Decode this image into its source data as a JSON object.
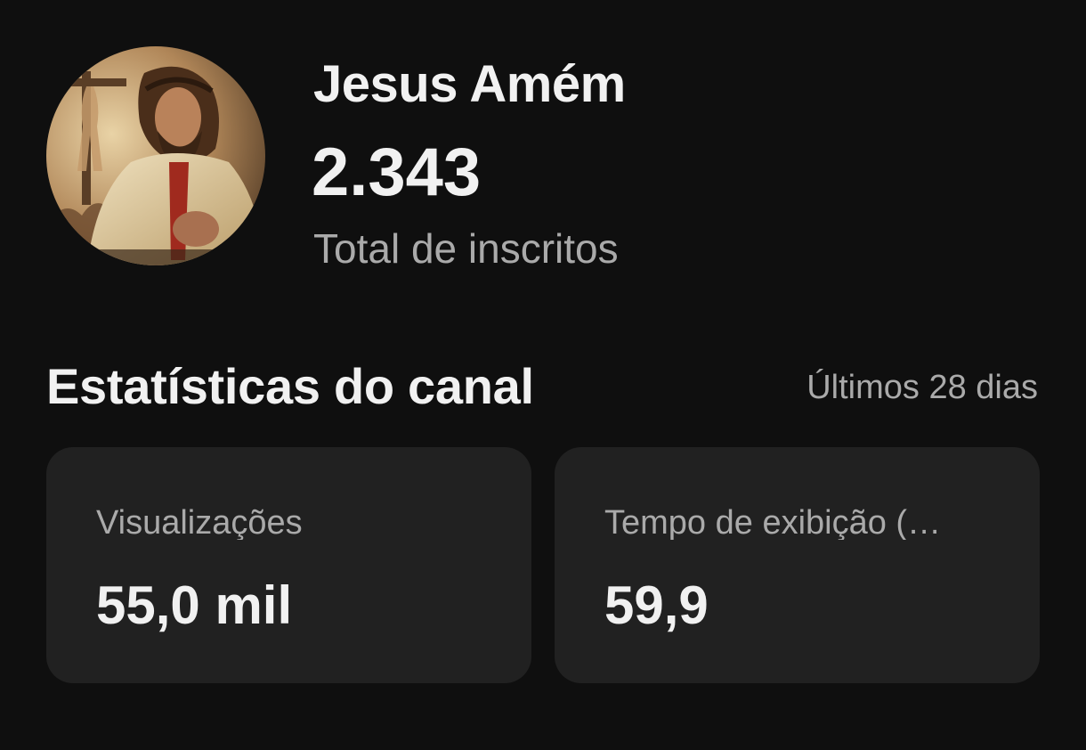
{
  "channel": {
    "name": "Jesus Amém",
    "subscriber_count": "2.343",
    "subscriber_label": "Total de inscritos",
    "avatar_icon": "channel-avatar-image"
  },
  "stats": {
    "title": "Estatísticas do canal",
    "period": "Últimos 28 dias",
    "cards": [
      {
        "label": "Visualizações",
        "value": "55,0 mil"
      },
      {
        "label": "Tempo de exibição (…",
        "value": "59,9"
      }
    ]
  },
  "colors": {
    "background": "#0f0f0f",
    "card": "#212121",
    "primary_text": "#f1f1f1",
    "secondary_text": "#aaaaaa"
  }
}
